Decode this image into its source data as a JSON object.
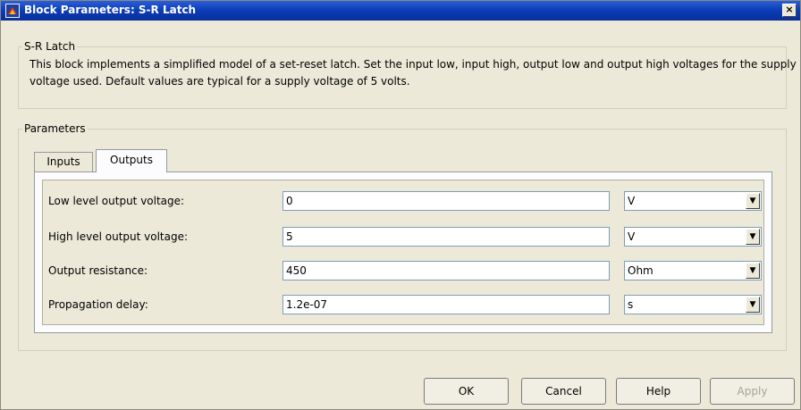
{
  "window": {
    "title": "Block Parameters: S-R Latch",
    "icon": "simulink-block-icon",
    "close_glyph": "×"
  },
  "description_group": {
    "legend": "S-R Latch",
    "text": "This block implements a simplified model of a set-reset latch. Set the input low, input high, output low and output high voltages for the supply voltage used. Default values are typical for a supply voltage of 5 volts."
  },
  "parameters_group": {
    "legend": "Parameters",
    "tabs": [
      {
        "label": "Inputs",
        "selected": false
      },
      {
        "label": "Outputs",
        "selected": true
      }
    ],
    "rows": [
      {
        "label": "Low level output voltage:",
        "value": "0",
        "unit": "V"
      },
      {
        "label": "High level output voltage:",
        "value": "5",
        "unit": "V"
      },
      {
        "label": "Output resistance:",
        "value": "450",
        "unit": "Ohm"
      },
      {
        "label": "Propagation delay:",
        "value": "1.2e-07",
        "unit": "s"
      }
    ]
  },
  "buttons": {
    "ok": "OK",
    "cancel": "Cancel",
    "help": "Help",
    "apply": "Apply"
  },
  "dropdown_arrow_glyph": "▼"
}
